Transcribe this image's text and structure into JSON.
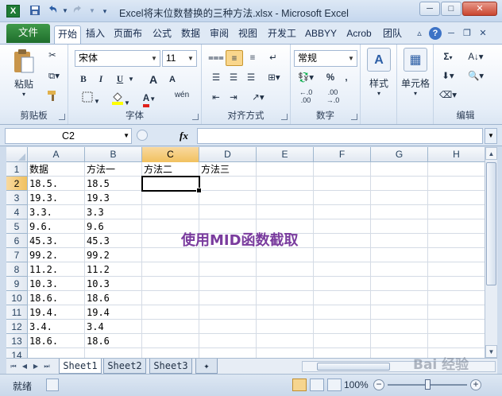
{
  "window": {
    "title": "Excel将末位数替换的三种方法.xlsx - Microsoft Excel",
    "app_icon_label": "X",
    "quick_access": [
      "save-icon",
      "undo-icon",
      "redo-icon",
      "customize-icon"
    ],
    "controls": [
      "minimize-icon",
      "maximize-icon",
      "close-icon"
    ]
  },
  "ribbon_tabs": {
    "file": "文件",
    "tabs": [
      "开始",
      "插入",
      "页面布",
      "公式",
      "数据",
      "审阅",
      "视图",
      "开发工",
      "ABBYY",
      "Acrob",
      "团队"
    ],
    "active_index": 0
  },
  "ribbon": {
    "clipboard": {
      "paste": "粘贴",
      "label": "剪贴板"
    },
    "font": {
      "name": "宋体",
      "size": "11",
      "bold": "B",
      "italic": "I",
      "underline": "U",
      "grow": "A",
      "shrink": "A",
      "font_color": "A",
      "phonetic": "wén",
      "label": "字体"
    },
    "alignment": {
      "label": "对齐方式"
    },
    "number": {
      "format": "常规",
      "percent": "%",
      "comma": ",",
      "inc_decimal": "←.0 .00",
      "dec_decimal": ".00 →.0",
      "label": "数字"
    },
    "styles": {
      "label": "样式"
    },
    "cells": {
      "label": "单元格"
    },
    "editing": {
      "sum": "Σ",
      "label": "编辑"
    }
  },
  "formula_bar": {
    "name_box": "C2",
    "fx": "fx",
    "value": ""
  },
  "grid": {
    "columns": [
      "A",
      "B",
      "C",
      "D",
      "E",
      "F",
      "G",
      "H"
    ],
    "selected_column": "C",
    "rows": [
      [
        "数据",
        "方法一",
        "方法二",
        "方法三"
      ],
      [
        "18.5.",
        "18.5",
        "",
        ""
      ],
      [
        "19.3.",
        "19.3",
        "",
        ""
      ],
      [
        "3.3.",
        "3.3",
        "",
        ""
      ],
      [
        "9.6.",
        "9.6",
        "",
        ""
      ],
      [
        "45.3.",
        "45.3",
        "",
        ""
      ],
      [
        "99.2.",
        "99.2",
        "",
        ""
      ],
      [
        "11.2.",
        "11.2",
        "",
        ""
      ],
      [
        "10.3.",
        "10.3",
        "",
        ""
      ],
      [
        "18.6.",
        "18.6",
        "",
        ""
      ],
      [
        "19.4.",
        "19.4",
        "",
        ""
      ],
      [
        "3.4.",
        "3.4",
        "",
        ""
      ],
      [
        "18.6.",
        "18.6",
        "",
        ""
      ],
      [
        "",
        "",
        "",
        ""
      ]
    ],
    "row_numbers": [
      "1",
      "2",
      "3",
      "4",
      "5",
      "6",
      "7",
      "8",
      "9",
      "10",
      "11",
      "12",
      "13",
      "14"
    ],
    "selected_row": "2",
    "active_cell": "C2",
    "overlay_text": "使用MID函数截取"
  },
  "sheets": {
    "tabs": [
      "Sheet1",
      "Sheet2",
      "Sheet3"
    ],
    "active": "Sheet1"
  },
  "status": {
    "ready": "就绪",
    "zoom": "100%",
    "zoom_level_percent": 100,
    "watermark": "Bai 经验"
  },
  "colors": {
    "file_tab": "#1f6e2c",
    "selection_header": "#f1c15f",
    "overlay_text": "#7a3c9e",
    "font_color_bar": "#e0201b",
    "highlight_bar": "#ffff00"
  }
}
